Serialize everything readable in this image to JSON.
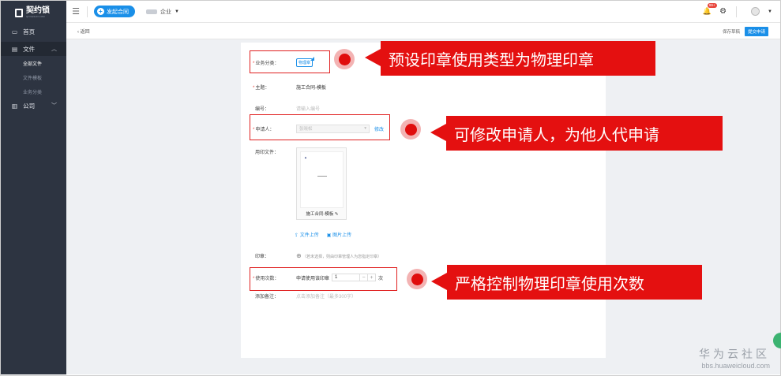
{
  "sidebar": {
    "logo_text": "契约锁",
    "logo_sub": "QIYUESUO.COM",
    "items": [
      {
        "label": "首页",
        "icon": "monitor-icon"
      },
      {
        "label": "文件",
        "icon": "file-icon"
      },
      {
        "label": "公司",
        "icon": "building-icon"
      }
    ],
    "sub_items": [
      "全部文件",
      "文件模板",
      "业务分类"
    ]
  },
  "topbar": {
    "new_contract_label": "发起合同",
    "company_label": "企业",
    "badge_count": "99+"
  },
  "subbar": {
    "back_label": "返回",
    "save_draft_label": "保存草稿",
    "submit_label": "提交申请"
  },
  "form": {
    "category": {
      "label": "业务分类：",
      "value": "物理章"
    },
    "subject": {
      "label": "主题：",
      "value": "施工合同-模板"
    },
    "number": {
      "label": "编号：",
      "placeholder": "请输入编号"
    },
    "applicant": {
      "label": "申请人：",
      "value": "张晓松",
      "action": "修改"
    },
    "files": {
      "label": "用印文件：",
      "doc_name": "施工合同-模板",
      "upload_file": "文件上传",
      "upload_image": "图片上传"
    },
    "seal": {
      "label": "印章：",
      "hint": "（若未选择，则由印章管理人为您指定印章）"
    },
    "usage": {
      "label": "使用次数：",
      "prefix": "申请使用该印章",
      "value": "1",
      "suffix": "次"
    },
    "remark": {
      "label": "添加备注：",
      "placeholder": "点击添加备注（最多300字）"
    }
  },
  "callouts": [
    "预设印章使用类型为物理印章",
    "可修改申请人，为他人代申请",
    "严格控制物理印章使用次数"
  ],
  "watermark": {
    "cn": "华为云社区",
    "en": "bbs.huaweicloud.com"
  },
  "colors": {
    "primary": "#1a8fe8",
    "sidebar": "#2d3441",
    "callout": "#e41010"
  }
}
